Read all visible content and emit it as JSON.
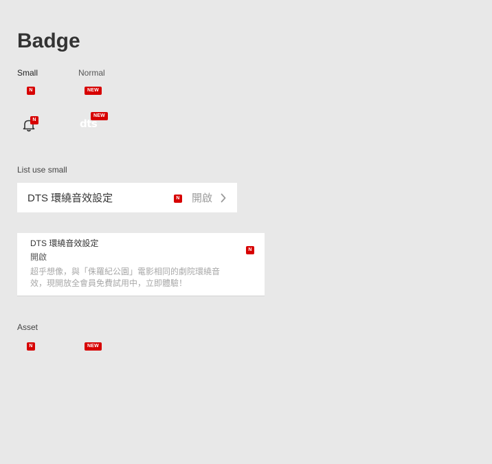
{
  "page_title": "Badge",
  "sizes": {
    "small_label": "Small",
    "normal_label": "Normal"
  },
  "badges": {
    "small_text": "N",
    "normal_text": "NEW"
  },
  "icons": {
    "bell": "bell-icon",
    "dts": "dts-logo-icon",
    "chevron": "chevron-right-icon"
  },
  "logo_text": "dts",
  "list_section_label": "List use small",
  "list_item": {
    "title": "DTS 環繞音效設定",
    "value": "開啟"
  },
  "card": {
    "title": "DTS 環繞音效設定",
    "status": "開啟",
    "description": "超乎想像，與「侏羅紀公園」電影相同的劇院環繞音效，現開放全會員免費試用中，立即體驗！"
  },
  "asset_section_label": "Asset",
  "colors": {
    "background": "#e8e8e8",
    "badge_red": "#d70000",
    "card_white": "#ffffff",
    "muted_text": "#9a9a9a"
  }
}
